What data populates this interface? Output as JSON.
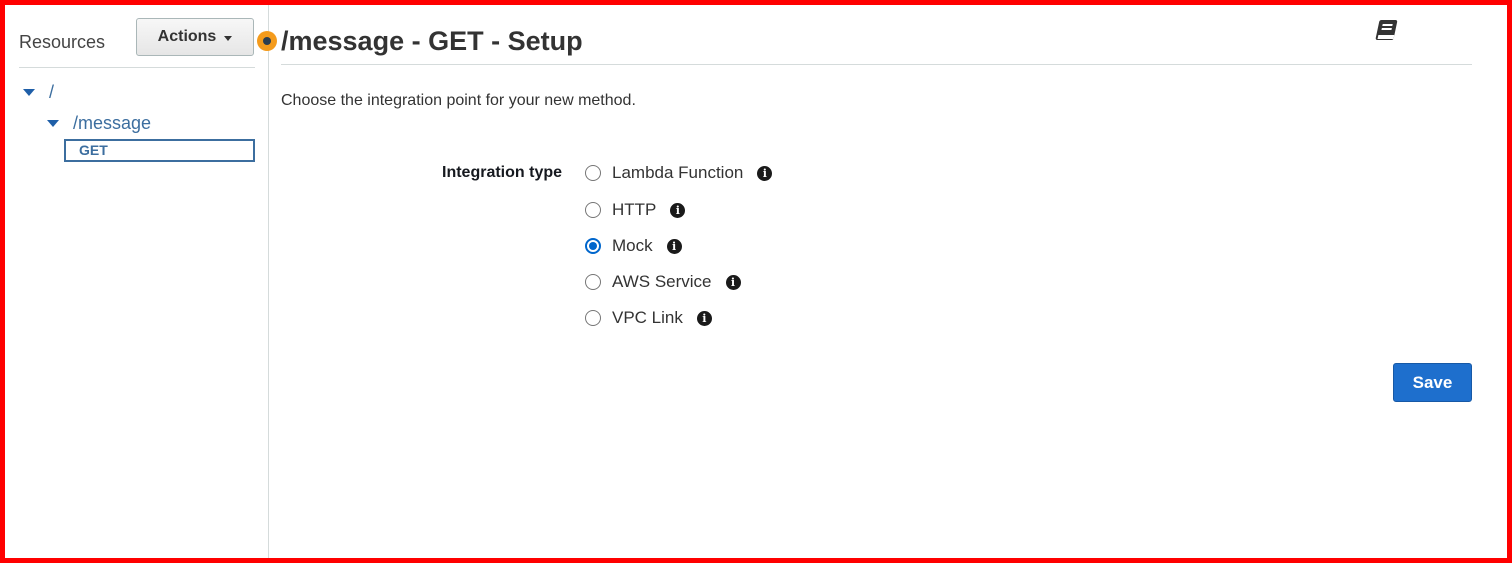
{
  "sidebar": {
    "title": "Resources",
    "actions_label": "Actions",
    "tree": [
      {
        "label": "/"
      },
      {
        "label": "/message"
      }
    ],
    "selected_method": "GET"
  },
  "main": {
    "title": "/message - GET - Setup",
    "description": "Choose the integration point for your new method.",
    "integration_label": "Integration type",
    "options": [
      {
        "label": "Lambda Function",
        "checked": false
      },
      {
        "label": "HTTP",
        "checked": false
      },
      {
        "label": "Mock",
        "checked": true
      },
      {
        "label": "AWS Service",
        "checked": false
      },
      {
        "label": "VPC Link",
        "checked": false
      }
    ],
    "save_label": "Save"
  },
  "icons": {
    "info": "info-icon",
    "book": "book-icon",
    "expand": "caret-down-icon"
  },
  "colors": {
    "accent": "#1e6fcd",
    "link": "#3c6e9f",
    "handle": "#f49b1c",
    "frame": "#ff0000"
  }
}
